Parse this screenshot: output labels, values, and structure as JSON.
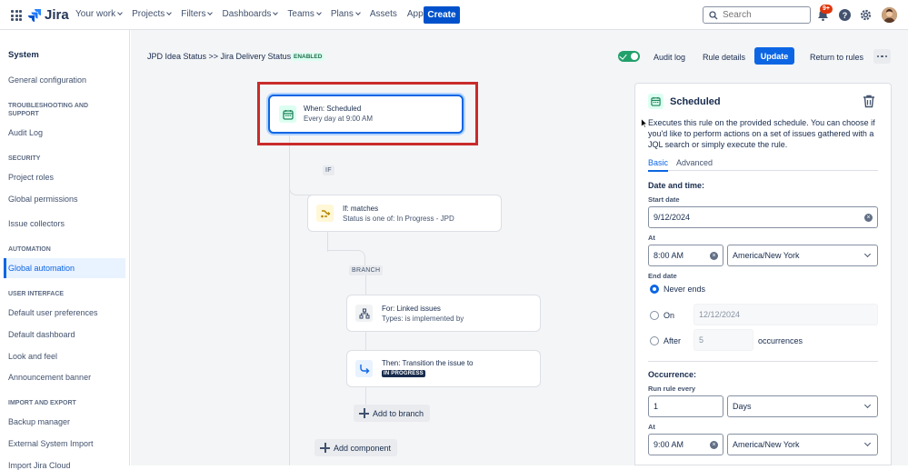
{
  "app": {
    "name": "Jira"
  },
  "topnav": {
    "items": [
      "Your work",
      "Projects",
      "Filters",
      "Dashboards",
      "Teams",
      "Plans",
      "Assets",
      "Apps"
    ],
    "create_label": "Create",
    "search_placeholder": "Search",
    "notification_count": "9+"
  },
  "sidebar": {
    "title": "System",
    "general": "General configuration",
    "troubleshooting_heading": "TROUBLESHOOTING AND SUPPORT",
    "audit_log": "Audit Log",
    "security_heading": "SECURITY",
    "project_roles": "Project roles",
    "global_permissions": "Global permissions",
    "issue_collectors": "Issue collectors",
    "automation_heading": "AUTOMATION",
    "global_automation": "Global automation",
    "ui_heading": "USER INTERFACE",
    "default_user_prefs": "Default user preferences",
    "default_dashboard": "Default dashboard",
    "look_and_feel": "Look and feel",
    "announcement_banner": "Announcement banner",
    "import_export_heading": "IMPORT AND EXPORT",
    "backup_manager": "Backup manager",
    "external_import": "External System Import",
    "import_cloud": "Import Jira Cloud"
  },
  "header": {
    "breadcrumb": "JPD Idea Status >> Jira Delivery Status",
    "status": "ENABLED",
    "audit_log": "Audit log",
    "rule_details": "Rule details",
    "update": "Update",
    "return_to_rules": "Return to rules"
  },
  "flow": {
    "trigger": {
      "title": "When: Scheduled",
      "subtitle": "Every day at 9:00 AM"
    },
    "if_label": "IF",
    "condition": {
      "title": "If: matches",
      "subtitle": "Status is one of: In Progress - JPD"
    },
    "branch_label": "BRANCH",
    "branch": {
      "title": "For: Linked issues",
      "subtitle": "Types: is implemented by"
    },
    "action": {
      "title": "Then: Transition the issue to",
      "status": "IN PROGRESS"
    },
    "add_to_branch": "Add to branch",
    "add_component": "Add component"
  },
  "panel": {
    "title": "Scheduled",
    "description": "Executes this rule on the provided schedule. You can choose if you'd like to perform actions on a set of issues gathered with a JQL search or simply execute the rule.",
    "tabs": [
      "Basic",
      "Advanced"
    ],
    "date_time_heading": "Date and time:",
    "start_date_label": "Start date",
    "start_date": "9/12/2024",
    "at_label": "At",
    "start_time": "8:00 AM",
    "timezone": "America/New York",
    "end_date_label": "End date",
    "never_ends": "Never ends",
    "on_label": "On",
    "on_date": "12/12/2024",
    "after_label": "After",
    "after_count": "5",
    "occurrences": "occurrences",
    "occurrence_heading": "Occurrence:",
    "run_rule_every_label": "Run rule every",
    "run_every_value": "1",
    "run_every_unit": "Days",
    "at2_label": "At",
    "occurrence_time": "9:00 AM",
    "timezone2": "America/New York"
  },
  "colors": {
    "brand": "#0052cc",
    "primary": "#0c66e4",
    "success": "#22a06b",
    "highlight": "#c92b2b"
  }
}
